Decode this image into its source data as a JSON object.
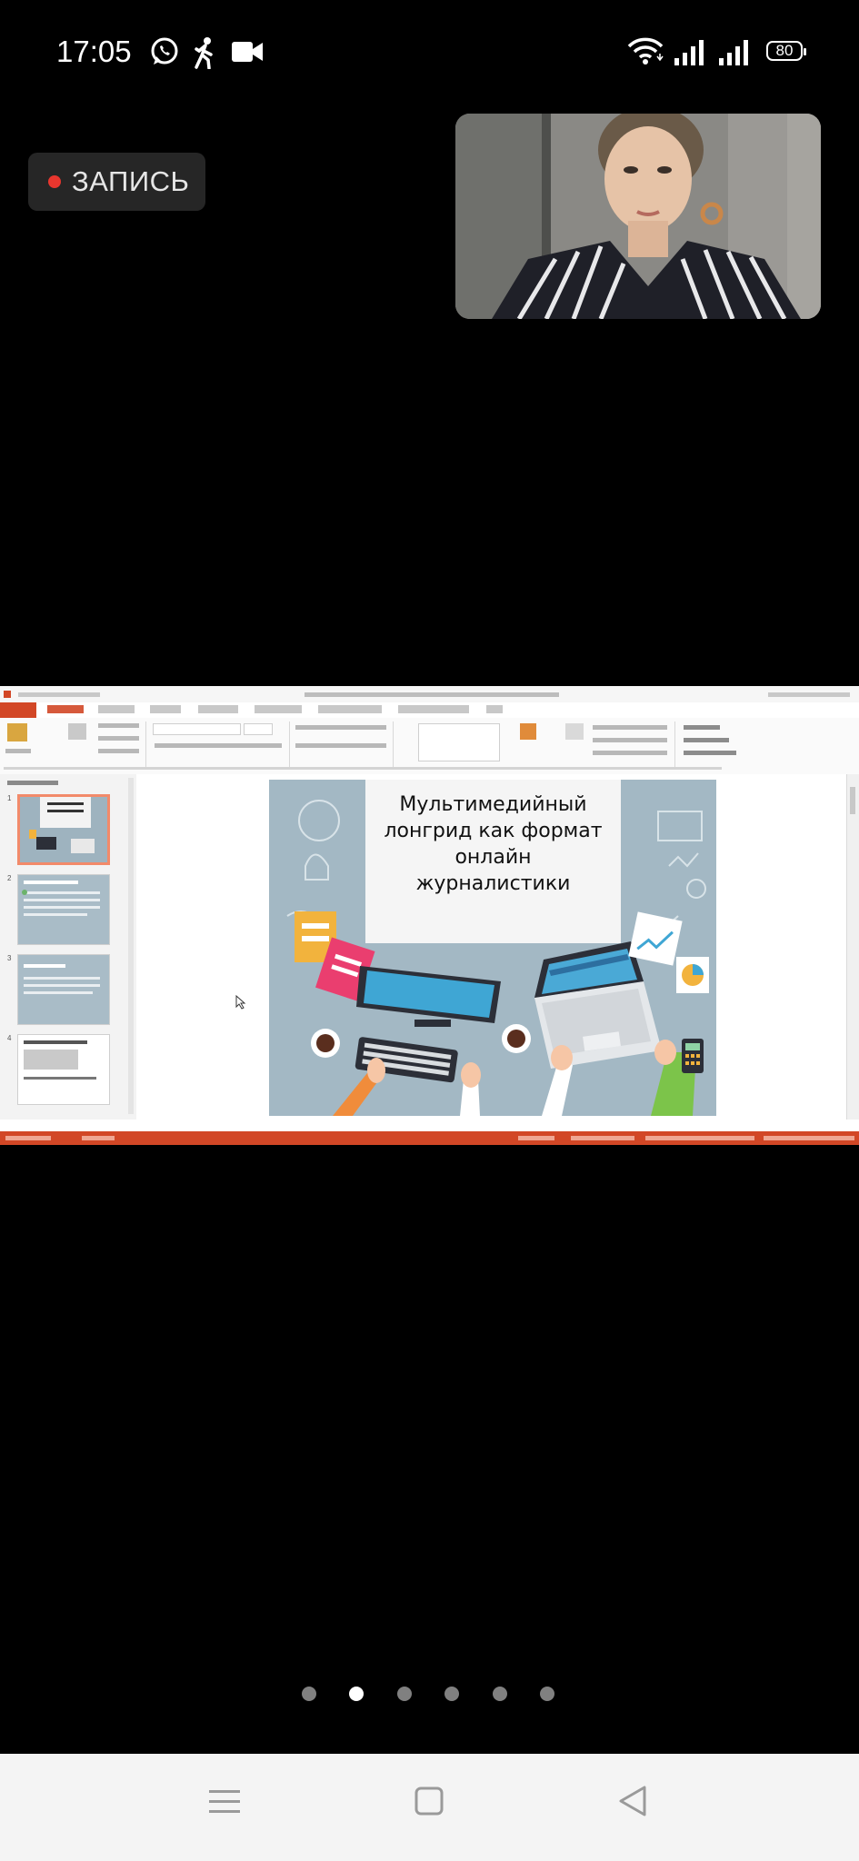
{
  "status_bar": {
    "time": "17:05",
    "battery": "80",
    "notification_icons": [
      "whatsapp-icon",
      "walking-person-icon",
      "video-camera-icon"
    ],
    "system_icons": [
      "wifi-icon",
      "signal-icon",
      "signal-icon"
    ]
  },
  "recording": {
    "label": "ЗАПИСЬ",
    "dot_color": "#e8362e"
  },
  "shared_screen": {
    "app": "PowerPoint",
    "slide_title": "Мультимедийный\nлонгрид как формат\nонлайн\nжурналистики",
    "section_label": "Default Section",
    "slide_numbers": [
      "1",
      "2",
      "3",
      "4"
    ],
    "accent_color": "#d24726"
  },
  "pager": {
    "page_count": 6,
    "active_index": 1
  },
  "navbar": {
    "buttons": [
      "menu-icon",
      "home-square-icon",
      "back-triangle-icon"
    ]
  }
}
